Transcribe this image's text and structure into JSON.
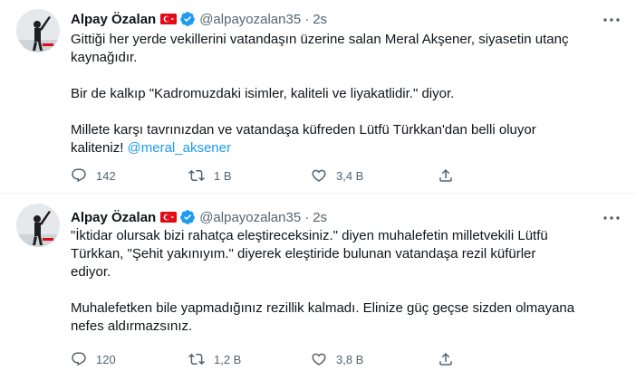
{
  "tweets": [
    {
      "author_name": "Alpay Özalan",
      "handle": "@alpayozalan35",
      "separator": "·",
      "time": "2s",
      "paragraphs": [
        "Gittiği her yerde vekillerini vatandaşın üzerine salan Meral Akşener, siyasetin utanç kaynağıdır.",
        "Bir de kalkıp \"Kadromuzdaki isimler, kaliteli ve liyakatlidir.\" diyor.",
        "Millete karşı tavrınızdan ve vatandaşa küfreden Lütfü Türkkan'dan belli oluyor kaliteniz! "
      ],
      "mention": "@meral_aksener",
      "reply_count": "142",
      "retweet_count": "1 B",
      "like_count": "3,4 B"
    },
    {
      "author_name": "Alpay Özalan",
      "handle": "@alpayozalan35",
      "separator": "·",
      "time": "2s",
      "paragraphs": [
        "\"İktidar olursak bizi rahatça eleştireceksiniz.\" diyen muhalefetin milletvekili Lütfü Türkkan, \"Şehit yakınıyım.\" diyerek eleştiride bulunan vatandaşa rezil küfürler ediyor.",
        "Muhalefetken bile yapmadığınız rezillik kalmadı. Elinize güç geçse sizden olmayana nefes aldırmazsınız."
      ],
      "reply_count": "120",
      "retweet_count": "1,2 B",
      "like_count": "3,8 B"
    }
  ],
  "icons": {
    "flag": "turkey-flag-icon",
    "verified": "verified-badge-icon",
    "more": "more-options-icon",
    "reply": "reply-icon",
    "retweet": "retweet-icon",
    "like": "heart-icon",
    "share": "share-icon"
  },
  "colors": {
    "text": "#0f1419",
    "secondary": "#536471",
    "link": "#1d9bf0",
    "verified": "#1d9bf0",
    "flag": "#e30a17",
    "divider": "#eff3f4"
  }
}
